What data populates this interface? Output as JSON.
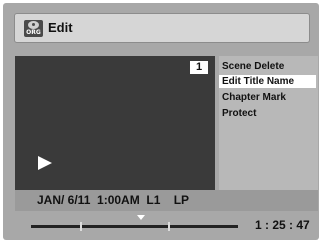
{
  "header": {
    "icon_label": "ORG",
    "title": "Edit"
  },
  "video": {
    "title_number": "1"
  },
  "menu": {
    "items": [
      {
        "label": "Scene Delete",
        "selected": false
      },
      {
        "label": "Edit Title Name",
        "selected": true
      },
      {
        "label": "Chapter Mark",
        "selected": false
      },
      {
        "label": "Protect",
        "selected": false
      }
    ]
  },
  "status": {
    "info": "JAN/ 6/11  1:00AM  L1    LP"
  },
  "timeline": {
    "elapsed": "1 : 25 : 47",
    "position_fraction": 0.53
  }
}
